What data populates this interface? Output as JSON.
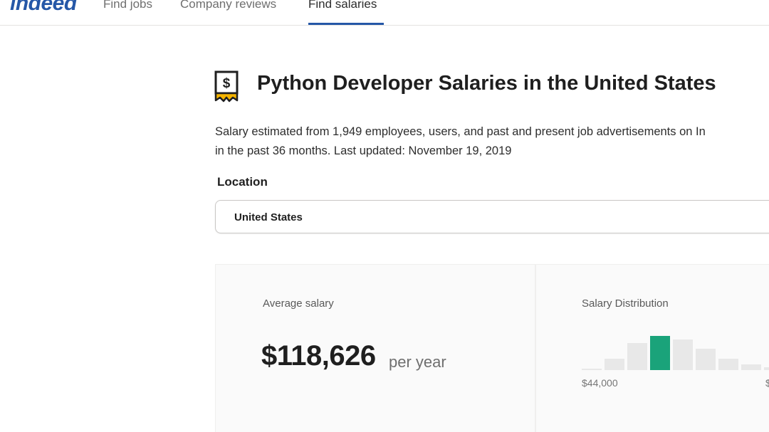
{
  "nav": {
    "logo": "indeed",
    "items": [
      "Find jobs",
      "Company reviews",
      "Find salaries"
    ],
    "active_index": 2
  },
  "header": {
    "title": "Python Developer Salaries in the United States",
    "description_line1": "Salary estimated from 1,949 employees, users, and past and present job advertisements on In",
    "description_line2": "in the past 36 months. Last updated: November 19, 2019"
  },
  "location": {
    "label": "Location",
    "value": "United States"
  },
  "average": {
    "label": "Average salary",
    "value": "$118,626",
    "period": "per year"
  },
  "distribution": {
    "label": "Salary Distribution",
    "tick_left": "$44,000",
    "tick_right": "$",
    "colors": {
      "bar": "#e8e8e8",
      "highlight": "#1aa37a"
    }
  },
  "chart_data": {
    "type": "bar",
    "title": "Salary Distribution",
    "values": [
      2,
      16,
      37,
      47,
      42,
      29,
      16,
      8,
      4
    ],
    "highlight_index": 3,
    "xlabel": "",
    "ylabel": "",
    "tick_labels": [
      "$44,000"
    ]
  }
}
